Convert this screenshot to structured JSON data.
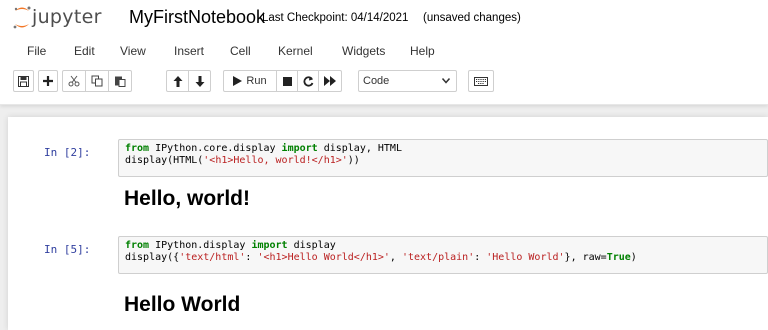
{
  "header": {
    "logo_text": "jupyter",
    "notebook_name": "MyFirstNotebook",
    "checkpoint": "Last Checkpoint: 04/14/2021",
    "autosave_status": "(unsaved changes)"
  },
  "menu": [
    "File",
    "Edit",
    "View",
    "Insert",
    "Cell",
    "Kernel",
    "Widgets",
    "Help"
  ],
  "toolbar": {
    "run_label": "Run",
    "cell_type": "Code"
  },
  "cells": [
    {
      "prompt": "In [2]:",
      "code_lines": [
        [
          {
            "t": "kw",
            "v": "from"
          },
          {
            "t": "nm",
            "v": " IPython.core.display "
          },
          {
            "t": "kw",
            "v": "import"
          },
          {
            "t": "nm",
            "v": " display, HTML"
          }
        ],
        [
          {
            "t": "nm",
            "v": "display(HTML("
          },
          {
            "t": "str",
            "v": "'<h1>Hello, world!</h1>'"
          },
          {
            "t": "nm",
            "v": "))"
          }
        ]
      ],
      "output": "Hello, world!"
    },
    {
      "prompt": "In [5]:",
      "code_lines": [
        [
          {
            "t": "kw",
            "v": "from"
          },
          {
            "t": "nm",
            "v": " IPython.display "
          },
          {
            "t": "kw",
            "v": "import"
          },
          {
            "t": "nm",
            "v": " display"
          }
        ],
        [
          {
            "t": "nm",
            "v": "display({"
          },
          {
            "t": "str",
            "v": "'text/html'"
          },
          {
            "t": "nm",
            "v": ": "
          },
          {
            "t": "str",
            "v": "'<h1>Hello World</h1>'"
          },
          {
            "t": "nm",
            "v": ", "
          },
          {
            "t": "str",
            "v": "'text/plain'"
          },
          {
            "t": "nm",
            "v": ": "
          },
          {
            "t": "str",
            "v": "'Hello World'"
          },
          {
            "t": "nm",
            "v": "}, raw="
          },
          {
            "t": "kw",
            "v": "True"
          },
          {
            "t": "nm",
            "v": ")"
          }
        ]
      ],
      "output": "Hello World"
    }
  ]
}
